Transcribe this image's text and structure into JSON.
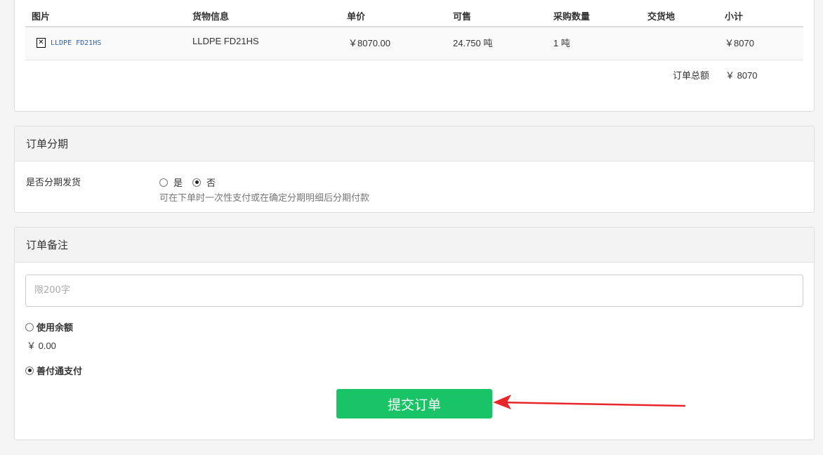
{
  "products": {
    "headers": [
      "图片",
      "货物信息",
      "单价",
      "可售",
      "采购数量",
      "交货地",
      "小计"
    ],
    "rows": [
      {
        "image_alt": "LLDPE FD21HS",
        "goods": "LLDPE FD21HS",
        "price": "￥8070.00",
        "available": "24.750 吨",
        "qty": "1 吨",
        "location": "",
        "subtotal": "￥8070"
      }
    ],
    "total_label": "订单总额",
    "total_value": "￥ 8070"
  },
  "installment": {
    "title": "订单分期",
    "label": "是否分期发货",
    "options": [
      "是",
      "否"
    ],
    "selected": "否",
    "hint": "可在下单时一次性支付或在确定分期明细后分期付款"
  },
  "remark": {
    "title": "订单备注",
    "placeholder": "限200字",
    "use_balance_label": "使用余额",
    "balance_value": "￥ 0.00",
    "pay_label": "善付通支付",
    "submit_label": "提交订单"
  },
  "colors": {
    "submit": "#19c466",
    "arrow": "#e8262a"
  }
}
